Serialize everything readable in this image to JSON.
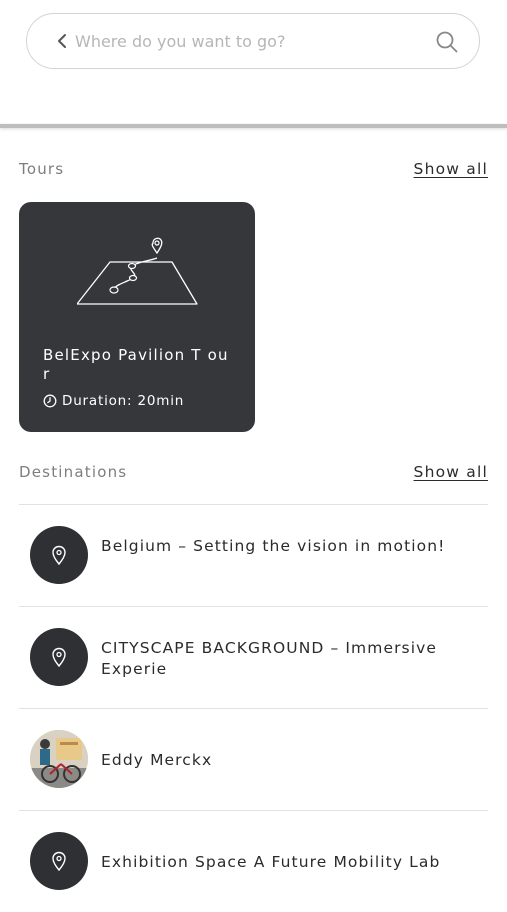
{
  "search": {
    "placeholder": "Where do you want to go?",
    "value": ""
  },
  "tours_section": {
    "title": "Tours",
    "show_all_label": "Show all"
  },
  "tours": [
    {
      "title": "BelExpo Pavilion T our",
      "duration": "Duration: 20min",
      "icon": "map-route-icon"
    }
  ],
  "destinations_section": {
    "title": "Destinations",
    "show_all_label": "Show all"
  },
  "destinations": [
    {
      "label": "Belgium – Setting the vision in motion!",
      "icon": "map-pin-icon"
    },
    {
      "label": "CITYSCAPE BACKGROUND – Immersive Experie",
      "icon": "map-pin-icon"
    },
    {
      "label": "Eddy Merckx",
      "icon": "eddy-merckx-thumbnail"
    },
    {
      "label": "Exhibition Space A Future Mobility Lab",
      "icon": "map-pin-icon"
    }
  ],
  "colors": {
    "card_background": "#35373a",
    "avatar_background": "#2f3033",
    "muted_text": "#7e7e7e",
    "primary_text": "#2b2b2b",
    "placeholder_text": "#b6b6b6"
  }
}
